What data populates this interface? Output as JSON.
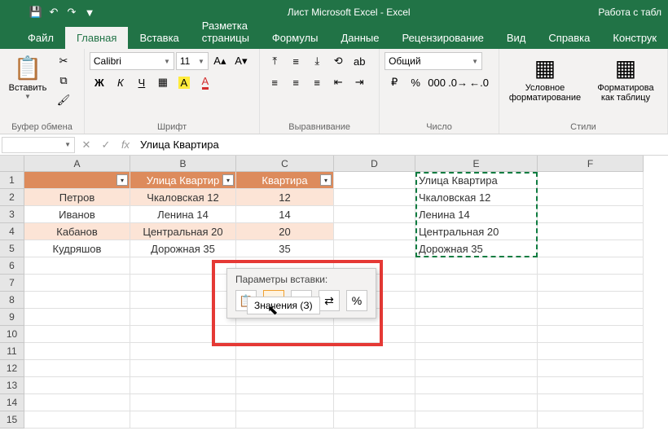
{
  "app": {
    "title": "Лист Microsoft Excel  -  Excel",
    "right_hint": "Работа с табл"
  },
  "tabs": [
    "Файл",
    "Главная",
    "Вставка",
    "Разметка страницы",
    "Формулы",
    "Данные",
    "Рецензирование",
    "Вид",
    "Справка",
    "Конструк"
  ],
  "active_tab": 1,
  "ribbon": {
    "clipboard": {
      "paste": "Вставить",
      "label": "Буфер обмена"
    },
    "font": {
      "name": "Calibri",
      "size": "11",
      "label": "Шрифт",
      "bold": "Ж",
      "italic": "К",
      "underline": "Ч"
    },
    "alignment": {
      "label": "Выравнивание"
    },
    "number": {
      "format": "Общий",
      "label": "Число"
    },
    "styles": {
      "cond": "Условное форматирование",
      "table": "Форматирова как таблицу",
      "label": "Стили"
    }
  },
  "formula_bar": {
    "name_box": "",
    "value": "Улица Квартира"
  },
  "columns": [
    "A",
    "B",
    "C",
    "D",
    "E",
    "F"
  ],
  "rows": [
    1,
    2,
    3,
    4,
    5,
    6,
    7,
    8,
    9,
    10,
    11,
    12,
    13,
    14,
    15
  ],
  "table": {
    "headers": [
      "",
      "Улица Квартир",
      "Квартира"
    ],
    "data": [
      [
        "Петров",
        "Чкаловская 12",
        "12"
      ],
      [
        "Иванов",
        "Ленина 14",
        "14"
      ],
      [
        "Кабанов",
        "Центральная 20",
        "20"
      ],
      [
        "Кудряшов",
        "Дорожная 35",
        "35"
      ]
    ]
  },
  "paste_target": [
    "Улица Квартира",
    "Чкаловская 12",
    "Ленина 14",
    "Центральная 20",
    "Дорожная 35"
  ],
  "paste_popup": {
    "title": "Параметры вставки:",
    "tooltip": "Значения (З)",
    "options": [
      "paste",
      "values",
      "formulas",
      "transpose",
      "percent"
    ]
  }
}
